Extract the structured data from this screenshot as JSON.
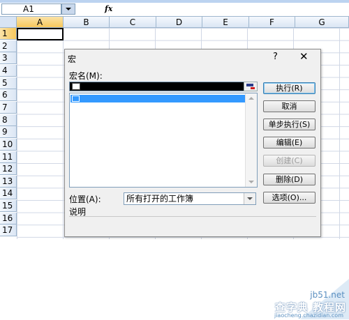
{
  "formula_bar": {
    "cell_ref": "A1",
    "fx_label": "fx"
  },
  "sheet": {
    "columns": [
      "A",
      "B",
      "C",
      "D",
      "E",
      "F",
      "G"
    ],
    "rows": [
      "1",
      "2",
      "3",
      "4",
      "5",
      "6",
      "7",
      "8",
      "9",
      "10",
      "11",
      "12",
      "13",
      "14",
      "15",
      "16",
      "17"
    ],
    "selected_column": "A",
    "selected_row": "1"
  },
  "dialog": {
    "title": "宏",
    "help": "?",
    "close": "✕",
    "macro_name_label": "宏名(M):",
    "buttons": {
      "run": "执行(R)",
      "cancel": "取消",
      "step": "单步执行(S)",
      "edit": "编辑(E)",
      "create": "创建(C)",
      "delete": "删除(D)",
      "options": "选项(O)..."
    },
    "location_label": "位置(A):",
    "location_value": "所有打开的工作簿",
    "description_label": "说明"
  },
  "watermark": {
    "site": "jb51.net",
    "cn": "查字典 教程网",
    "url": "jiaocheng.chazidian.com"
  }
}
